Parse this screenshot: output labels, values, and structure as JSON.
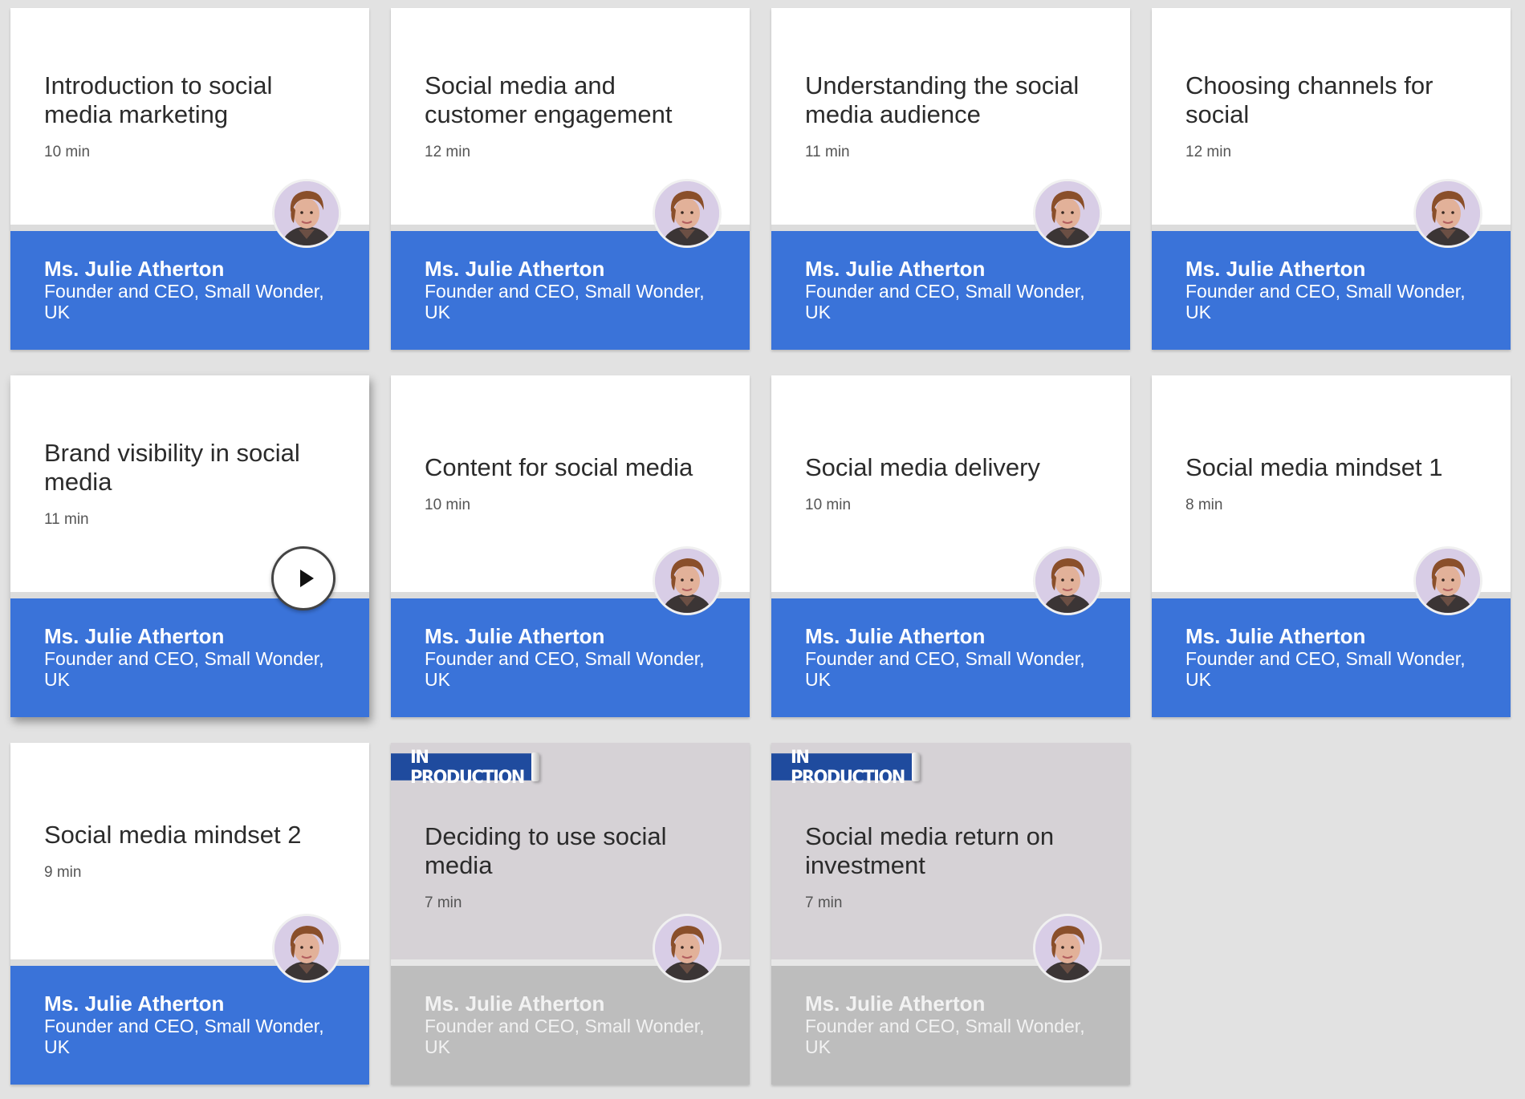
{
  "cards": [
    {
      "title": "Introduction to social media marketing",
      "duration": "10 min",
      "name": "Ms. Julie Atherton",
      "role": "Founder and CEO, Small Wonder, UK",
      "status": "",
      "icon": "avatar"
    },
    {
      "title": "Social media and customer engagement",
      "duration": "12 min",
      "name": "Ms. Julie Atherton",
      "role": "Founder and CEO, Small Wonder, UK",
      "status": "",
      "icon": "avatar"
    },
    {
      "title": "Understanding the social media audience",
      "duration": "11 min",
      "name": "Ms. Julie Atherton",
      "role": "Founder and CEO, Small Wonder, UK",
      "status": "",
      "icon": "avatar"
    },
    {
      "title": "Choosing channels for social",
      "duration": "12 min",
      "name": "Ms. Julie Atherton",
      "role": "Founder and CEO, Small Wonder, UK",
      "status": "",
      "icon": "avatar"
    },
    {
      "title": "Brand visibility in social media",
      "duration": "11 min",
      "name": "Ms. Julie Atherton",
      "role": "Founder and CEO, Small Wonder, UK",
      "status": "",
      "icon": "play-icon"
    },
    {
      "title": "Content for social media",
      "duration": "10 min",
      "name": "Ms. Julie Atherton",
      "role": "Founder and CEO, Small Wonder, UK",
      "status": "",
      "icon": "avatar"
    },
    {
      "title": "Social media delivery",
      "duration": "10 min",
      "name": "Ms. Julie Atherton",
      "role": "Founder and CEO, Small Wonder, UK",
      "status": "",
      "icon": "avatar"
    },
    {
      "title": "Social media mindset 1",
      "duration": "8 min",
      "name": "Ms. Julie Atherton",
      "role": "Founder and CEO, Small Wonder, UK",
      "status": "",
      "icon": "avatar"
    },
    {
      "title": "Social media mindset 2",
      "duration": "9 min",
      "name": "Ms. Julie Atherton",
      "role": "Founder and CEO, Small Wonder, UK",
      "status": "",
      "icon": "avatar"
    },
    {
      "title": "Deciding to use social media",
      "duration": "7 min",
      "name": "Ms. Julie Atherton",
      "role": "Founder and CEO, Small Wonder, UK",
      "status": "IN PRODUCTION",
      "icon": "avatar"
    },
    {
      "title": "Social media return on investment",
      "duration": "7 min",
      "name": "Ms. Julie Atherton",
      "role": "Founder and CEO, Small Wonder, UK",
      "status": "IN PRODUCTION",
      "icon": "avatar"
    }
  ],
  "colors": {
    "background": "#e2e2e2",
    "accent_blue": "#3a73d9",
    "badge_blue": "#1f4b9e",
    "production_gray": "#bdbdbd"
  }
}
